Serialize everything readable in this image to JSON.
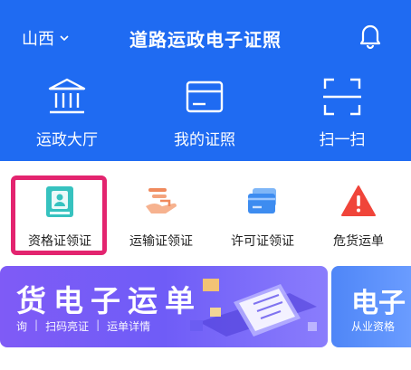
{
  "header": {
    "region": "山西",
    "title": "道路运政电子证照",
    "colors": {
      "background": "#1f6bf2",
      "text": "#ffffff"
    }
  },
  "topnav": {
    "items": [
      {
        "label": "运政大厅",
        "icon": "government-building-icon"
      },
      {
        "label": "我的证照",
        "icon": "card-icon"
      },
      {
        "label": "扫一扫",
        "icon": "scan-icon"
      }
    ]
  },
  "quick_actions": {
    "items": [
      {
        "label": "资格证领证",
        "icon": "qualification-cert-icon",
        "highlighted": true
      },
      {
        "label": "运输证领证",
        "icon": "transport-cert-icon"
      },
      {
        "label": "许可证领证",
        "icon": "license-cert-icon"
      },
      {
        "label": "危货运单",
        "icon": "hazard-waybill-icon"
      }
    ],
    "highlight_color": "#e3246f"
  },
  "banners": [
    {
      "title": "货电子运单",
      "sub_items": [
        "询",
        "扫码亮证",
        "运单详情"
      ]
    },
    {
      "title": "电子",
      "subtitle": "从业资格"
    }
  ]
}
